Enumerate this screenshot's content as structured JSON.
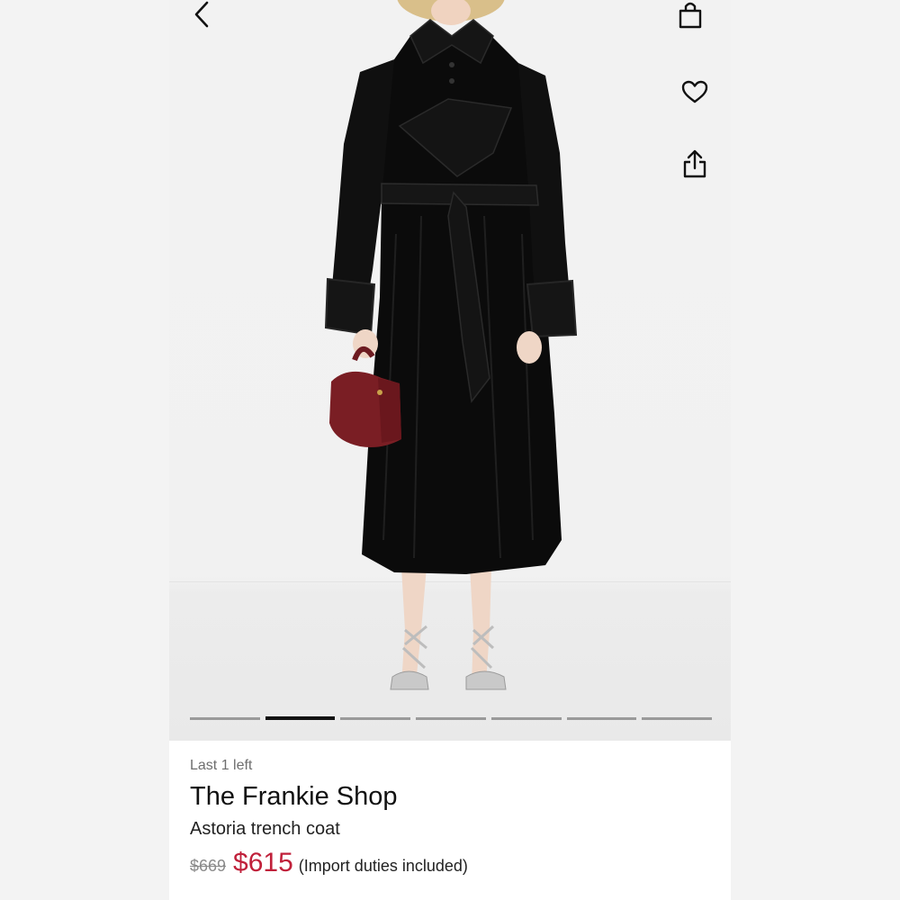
{
  "product": {
    "stock_label": "Last 1 left",
    "brand": "The Frankie Shop",
    "name": "Astoria trench coat",
    "original_price": "$669",
    "sale_price": "$615",
    "price_note": "(Import duties included)"
  },
  "gallery": {
    "image_count": 7,
    "active_index": 1
  },
  "icons": {
    "back": "chevron-left-icon",
    "bag": "shopping-bag-icon",
    "favorite": "heart-icon",
    "share": "share-icon"
  },
  "colors": {
    "sale_price": "#c0203a",
    "indicator_active": "#111111",
    "indicator_inactive": "#9a9a9a",
    "coat": "#0b0b0b",
    "handbag": "#7a1e24"
  }
}
